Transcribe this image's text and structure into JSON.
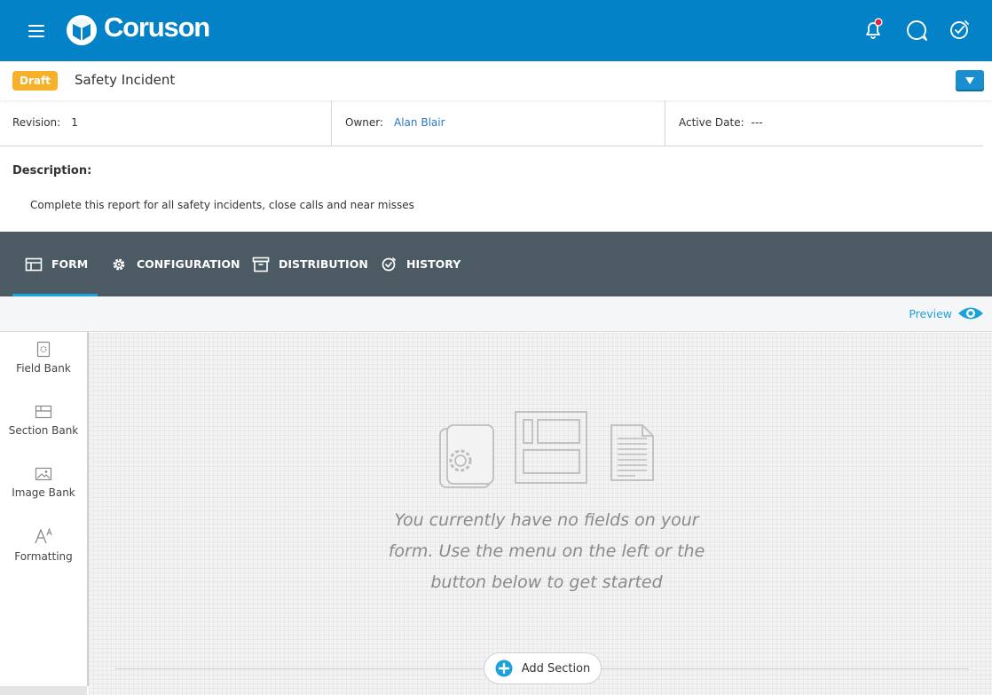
{
  "app": {
    "brand": "Coruson",
    "colors": {
      "header": "#0482c7",
      "accent": "#1da1dc",
      "draft": "#f6b129",
      "tabbar": "#4b5a63",
      "notification_dot": "#e0253a"
    }
  },
  "header": {
    "icons": [
      "menu-icon",
      "bell-icon",
      "chat-icon",
      "dashboard-icon"
    ]
  },
  "document": {
    "status": "Draft",
    "title": "Safety Incident",
    "revision_label": "Revision:",
    "revision_value": "1",
    "owner_label": "Owner:",
    "owner_value": "Alan Blair",
    "active_date_label": "Active Date:",
    "active_date_value": "---",
    "description_label": "Description:",
    "description_text": "Complete this report for all safety incidents, close calls and near misses"
  },
  "tabs": [
    {
      "label": "FORM",
      "icon": "table-icon",
      "active": true
    },
    {
      "label": "CONFIGURATION",
      "icon": "gear-icon",
      "active": false
    },
    {
      "label": "DISTRIBUTION",
      "icon": "archive-icon",
      "active": false
    },
    {
      "label": "HISTORY",
      "icon": "history-icon",
      "active": false
    }
  ],
  "toolbar": {
    "preview_label": "Preview"
  },
  "sidebar": {
    "items": [
      {
        "label": "Field Bank",
        "icon": "field-bank-icon"
      },
      {
        "label": "Section Bank",
        "icon": "section-bank-icon"
      },
      {
        "label": "Image Bank",
        "icon": "image-icon"
      },
      {
        "label": "Formatting",
        "icon": "font-size-icon"
      }
    ]
  },
  "canvas": {
    "empty_line1": "You currently have no fields on your",
    "empty_line2": "form. Use the menu on the left or the",
    "empty_line3": "button below to get started",
    "add_section_label": "Add Section"
  }
}
